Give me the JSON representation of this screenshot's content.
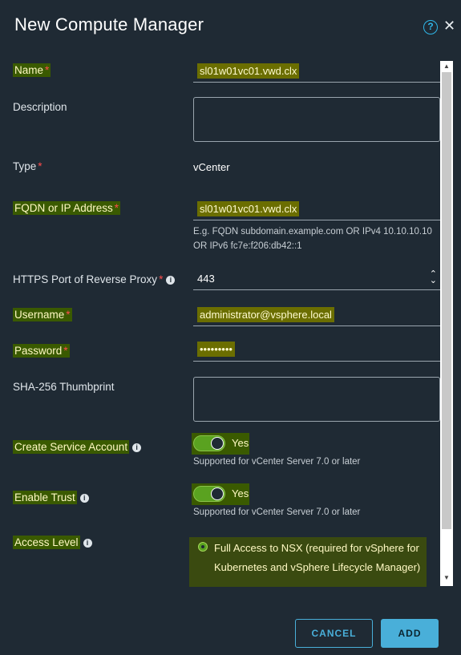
{
  "dialog": {
    "title": "New Compute Manager"
  },
  "form": {
    "name": {
      "label": "Name",
      "required": "*",
      "value": "sl01w01vc01.vwd.clx"
    },
    "description": {
      "label": "Description",
      "value": ""
    },
    "type": {
      "label": "Type",
      "required": "*",
      "value": "vCenter"
    },
    "fqdn": {
      "label": "FQDN or IP Address",
      "required": "*",
      "value": "sl01w01vc01.vwd.clx",
      "hint_line1": "E.g. FQDN subdomain.example.com OR IPv4 10.10.10.10",
      "hint_line2": "OR IPv6 fc7e:f206:db42::1"
    },
    "https_port": {
      "label": "HTTPS Port of Reverse Proxy",
      "required": "*",
      "value": "443"
    },
    "username": {
      "label": "Username",
      "required": "*",
      "value": "administrator@vsphere.local"
    },
    "password": {
      "label": "Password",
      "required": "*",
      "value": "•••••••••"
    },
    "thumbprint": {
      "label": "SHA-256 Thumbprint",
      "value": ""
    },
    "service_account": {
      "label": "Create Service Account",
      "toggle_text": "Yes",
      "hint": "Supported for vCenter Server 7.0 or later"
    },
    "enable_trust": {
      "label": "Enable Trust",
      "toggle_text": "Yes",
      "hint": "Supported for vCenter Server 7.0 or later"
    },
    "access_level": {
      "label": "Access Level",
      "option_text": "Full Access to NSX (required for vSphere for Kubernetes and vSphere Lifecycle Manager)"
    }
  },
  "footer": {
    "cancel_label": "CANCEL",
    "add_label": "ADD"
  },
  "colors": {
    "background": "#1f2a34",
    "accent": "#49afd9",
    "toggle_on": "#5aa220",
    "required": "#ff4c4c"
  },
  "icons": {
    "help": "help-circle-icon",
    "close": "close-icon",
    "info": "info-icon",
    "spinner": "number-spinner-icon"
  }
}
